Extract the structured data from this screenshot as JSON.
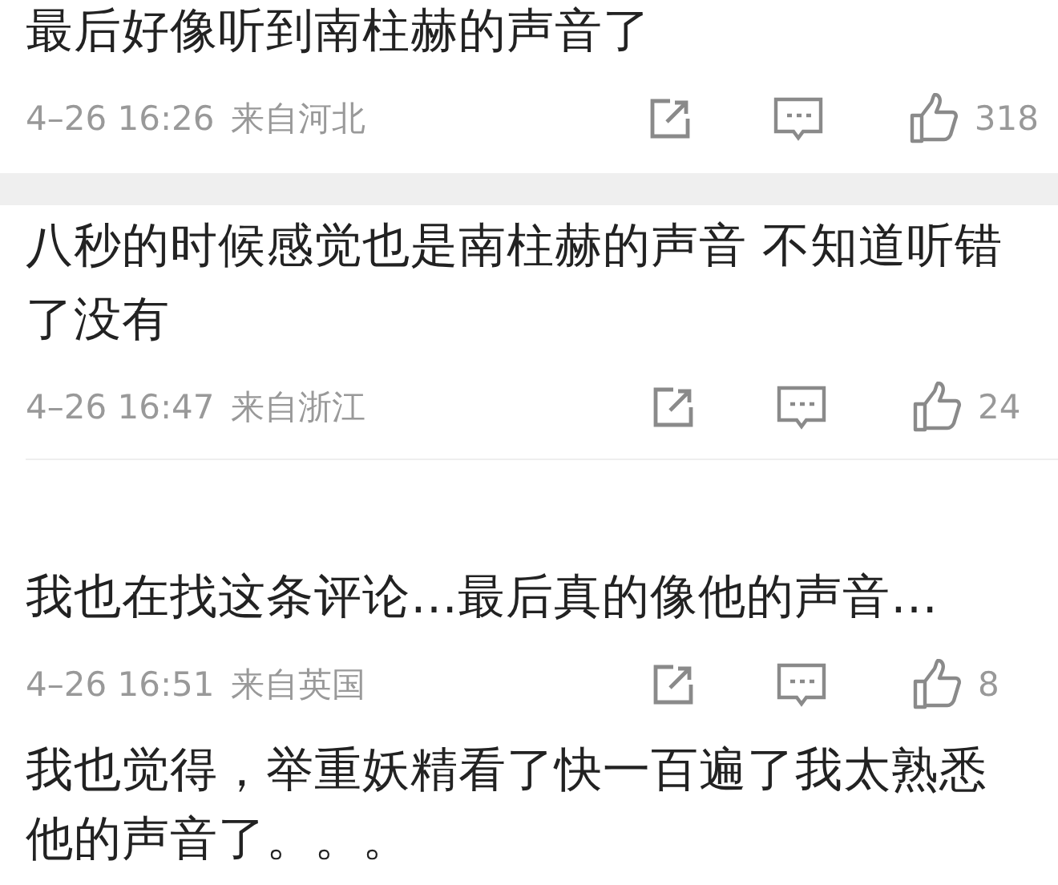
{
  "comments": [
    {
      "text": "最后好像听到南柱赫的声音了",
      "time": "4–26 16:26",
      "location": "来自河北",
      "likes": "318",
      "gap_below": true
    },
    {
      "text": "八秒的时候感觉也是南柱赫的声音 不知道听错了没有",
      "time": "4–26 16:47",
      "location": "来自浙江",
      "likes": "24",
      "rule_below": true
    },
    {
      "text": "我也在找这条评论…最后真的像他的声音…",
      "time": "4–26 16:51",
      "location": "来自英国",
      "likes": "8"
    },
    {
      "text": "我也觉得，举重妖精看了快一百遍了我太熟悉他的声音了。。。"
    }
  ]
}
